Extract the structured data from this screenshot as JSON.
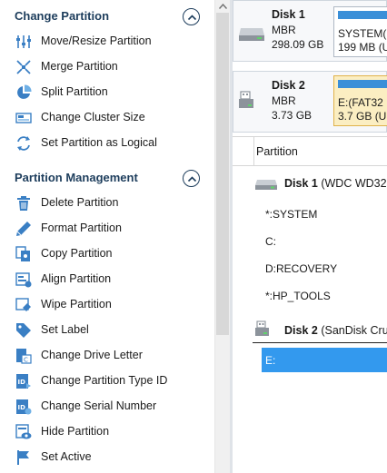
{
  "change_partition": {
    "title": "Change Partition",
    "items": [
      {
        "label": "Move/Resize Partition",
        "icon": "move-resize-icon"
      },
      {
        "label": "Merge Partition",
        "icon": "merge-icon"
      },
      {
        "label": "Split Partition",
        "icon": "split-icon"
      },
      {
        "label": "Change Cluster Size",
        "icon": "cluster-size-icon"
      },
      {
        "label": "Set Partition as Logical",
        "icon": "set-logical-icon"
      }
    ]
  },
  "partition_management": {
    "title": "Partition Management",
    "items": [
      {
        "label": "Delete Partition",
        "icon": "trash-icon"
      },
      {
        "label": "Format Partition",
        "icon": "pen-icon"
      },
      {
        "label": "Copy Partition",
        "icon": "copy-icon"
      },
      {
        "label": "Align Partition",
        "icon": "align-icon"
      },
      {
        "label": "Wipe Partition",
        "icon": "eraser-icon"
      },
      {
        "label": "Set Label",
        "icon": "tag-icon"
      },
      {
        "label": "Change Drive Letter",
        "icon": "drive-letter-icon"
      },
      {
        "label": "Change Partition Type ID",
        "icon": "type-id-icon"
      },
      {
        "label": "Change Serial Number",
        "icon": "serial-number-icon"
      },
      {
        "label": "Hide Partition",
        "icon": "hide-icon"
      },
      {
        "label": "Set Active",
        "icon": "flag-icon"
      }
    ]
  },
  "disk_map": {
    "disks": [
      {
        "name": "Disk 1",
        "type": "MBR",
        "size": "298.09 GB",
        "partition": {
          "name": "SYSTEM(N",
          "size": "199 MB (U"
        }
      },
      {
        "name": "Disk 2",
        "type": "MBR",
        "size": "3.73 GB",
        "partition": {
          "name": "E:(FAT32",
          "size": "3.7 GB (U"
        }
      }
    ]
  },
  "partition_table": {
    "column_header": "Partition",
    "disk1": {
      "name": "Disk 1",
      "detail": "(WDC WD32",
      "partitions": [
        "*:SYSTEM",
        "C:",
        "D:RECOVERY",
        "*:HP_TOOLS"
      ]
    },
    "disk2": {
      "name": "Disk 2",
      "detail": "(SanDisk Cru",
      "partitions": [
        "E:"
      ]
    }
  },
  "colors": {
    "accent": "#3399ee",
    "heading": "#1d3d5c",
    "selected_partition": "#fbeec2"
  }
}
